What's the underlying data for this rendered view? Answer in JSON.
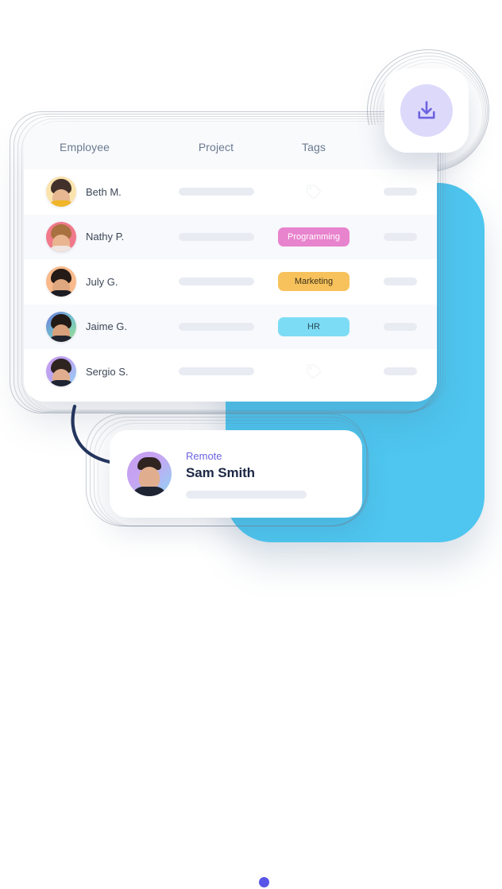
{
  "table": {
    "columns": [
      "Employee",
      "Project",
      "Tags",
      ""
    ],
    "rows": [
      {
        "name": "Beth M.",
        "avatar_bg": "#fbe3ae",
        "hair": "#42302a",
        "skin": "#e7b892",
        "shirt": "#f0b528",
        "tag": null,
        "tag_icon": "tag-outline-icon",
        "striped": false
      },
      {
        "name": "Nathy P.",
        "avatar_bg": "#f0798a",
        "hair": "#a9713f",
        "skin": "#e8b590",
        "shirt": "#f0e5e0",
        "tag": "Programming",
        "tag_bg": "#e883cd",
        "tag_fg": "#ffffff",
        "striped": true
      },
      {
        "name": "July G.",
        "avatar_bg": "#f9b98a",
        "hair": "#241a16",
        "skin": "#dfa77f",
        "shirt": "#1c1c22",
        "tag": "Marketing",
        "tag_bg": "#f7c25c",
        "tag_fg": "#3d3118",
        "striped": false
      },
      {
        "name": "Jaime G.",
        "avatar_bg": "linear-gradient(135deg,#6b79e0 0%,#74c4c9 55%,#9fe08a 100%)",
        "hair": "#221a16",
        "skin": "#d9a17b",
        "shirt": "#21242f",
        "tag": "HR",
        "tag_bg": "#7ddcf5",
        "tag_fg": "#2b4a57",
        "striped": true
      },
      {
        "name": "Sergio S.",
        "avatar_bg": "linear-gradient(135deg,#c79bf0 0%,#b7a7f2 50%,#8fd4f5 100%)",
        "hair": "#2e2420",
        "skin": "#e0ae8e",
        "shirt": "#1f2433",
        "tag": null,
        "tag_icon": "tag-outline-icon",
        "striped": false
      }
    ]
  },
  "download_button": {
    "icon": "download-icon",
    "icon_color": "#6c63e0",
    "circle_color": "#ddd9fb"
  },
  "profile_card": {
    "role": "Remote",
    "name": "Sam Smith",
    "role_color": "#6c63e0",
    "status": "online"
  },
  "colors": {
    "blue_shape": "#4ec6ef",
    "header_text": "#6b7a90",
    "placeholder_bar": "#e8ebf2",
    "card_white": "#ffffff",
    "row_stripe": "#f7f9fc",
    "arrow": "#24355e"
  }
}
